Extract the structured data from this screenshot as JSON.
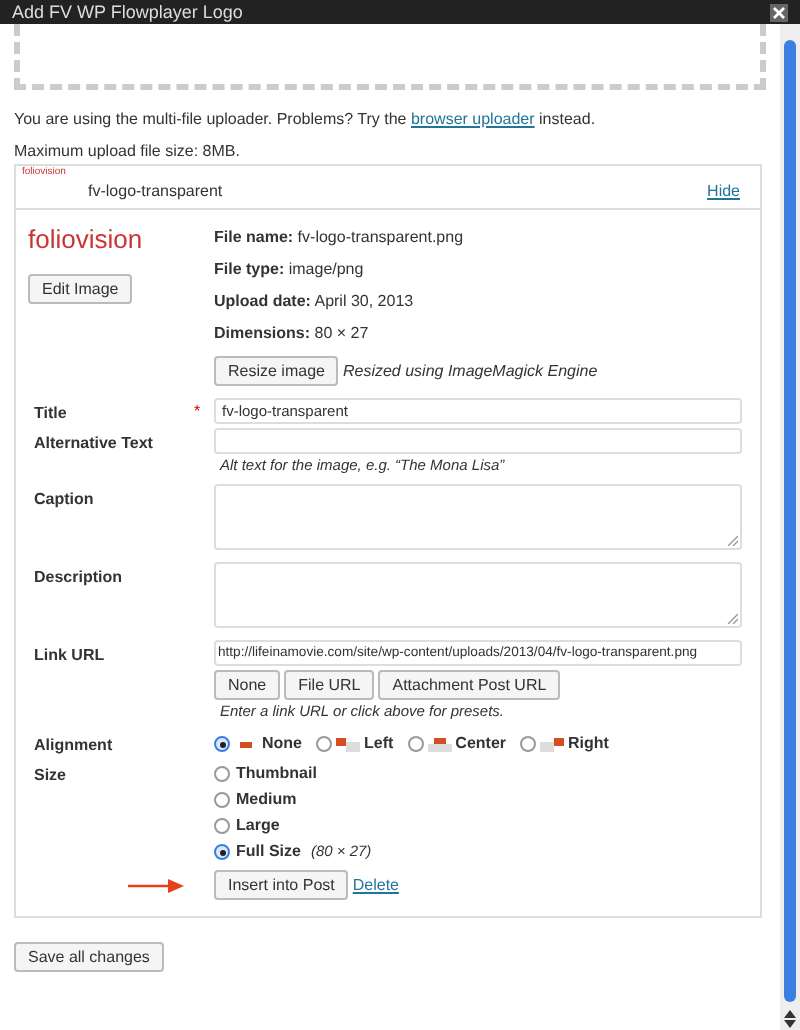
{
  "window": {
    "title": "Add FV WP Flowplayer Logo"
  },
  "uploader": {
    "notice_before": "You are using the multi-file uploader. Problems? Try the",
    "notice_link": "browser uploader",
    "notice_after": "instead.",
    "max_upload": "Maximum upload file size: 8MB."
  },
  "attachment": {
    "thumbnail_logo": "foliovision",
    "title": "fv-logo-transparent",
    "hide_link": "Hide",
    "preview_logo": "foliovision",
    "details": [
      {
        "label": "File name:",
        "value": "fv-logo-transparent.png"
      },
      {
        "label": "File type:",
        "value": "image/png"
      },
      {
        "label": "Upload date:",
        "value": "April 30, 2013"
      },
      {
        "label": "Dimensions:",
        "value": "80 × 27"
      }
    ],
    "edit_button": "Edit Image",
    "resize_button": "Resize image",
    "resize_note": "Resized using ImageMagick Engine",
    "fields": [
      {
        "label": "Title",
        "kind": "text",
        "value": "fv-logo-transparent",
        "required_mark": "*"
      },
      {
        "label": "Alternative Text",
        "kind": "text",
        "hint": "Alt text for the image, e.g. “The Mona Lisa”"
      },
      {
        "label": "Caption",
        "kind": "textarea"
      },
      {
        "label": "Description",
        "kind": "textarea"
      },
      {
        "label": "Link URL",
        "kind": "url",
        "value": "http://lifeinamovie.com/site/wp-content/uploads/2013/04/fv-logo-transparent.png",
        "buttons": [
          "None",
          "File URL",
          "Attachment Post URL"
        ],
        "hint": "Enter a link URL or click above for presets."
      }
    ],
    "alignment": {
      "label": "Alignment",
      "options": [
        {
          "label": "None",
          "kind": "none",
          "selected": true
        },
        {
          "label": "Left",
          "kind": "left",
          "selected": false
        },
        {
          "label": "Center",
          "kind": "center",
          "selected": false
        },
        {
          "label": "Right",
          "kind": "right",
          "selected": false
        }
      ]
    },
    "size": {
      "label": "Size",
      "options": [
        {
          "label": "Thumbnail",
          "selected": false
        },
        {
          "label": "Medium",
          "selected": false
        },
        {
          "label": "Large",
          "selected": false
        },
        {
          "label": "Full Size",
          "selected": true,
          "note": "(80 × 27)"
        }
      ]
    },
    "insert_button": "Insert into Post",
    "delete_link": "Delete"
  },
  "save_button": "Save all changes"
}
